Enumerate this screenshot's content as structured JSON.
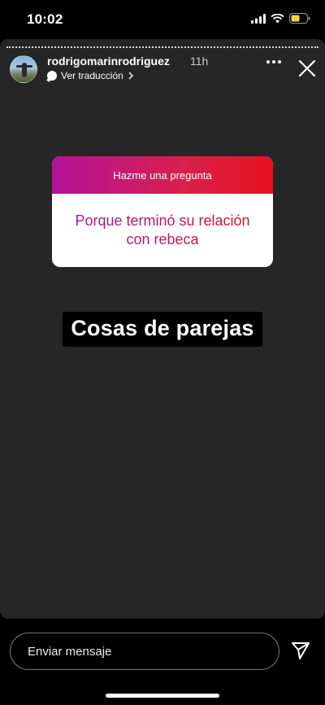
{
  "status_bar": {
    "time": "10:02",
    "icons": [
      "signal-icon",
      "wifi-icon",
      "battery-icon"
    ],
    "battery_color": "#f5d33a"
  },
  "story": {
    "username": "rodrigomarinrodriguez",
    "time_ago": "11h",
    "translate_label": "Ver traducción",
    "background_color": "#262626",
    "question_sticker": {
      "title": "Hazme una pregunta",
      "text": "Porque terminó su relación con rebeca",
      "gradient": [
        "#b3139e",
        "#e8121e"
      ]
    },
    "caption": "Cosas de parejas"
  },
  "reply": {
    "placeholder": "Enviar mensaje"
  }
}
